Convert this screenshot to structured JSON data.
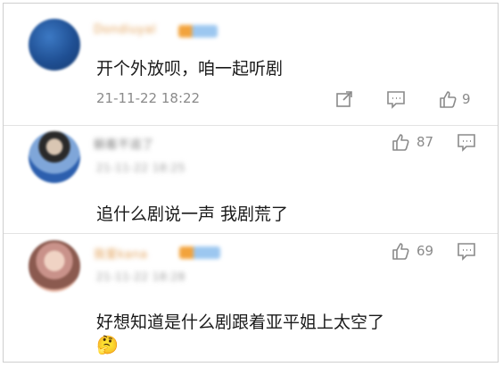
{
  "comments": [
    {
      "username": "Dondiuyal",
      "text": "开个外放呗，咱一起听剧",
      "timestamp": "21-11-22 18:22",
      "like_count": "9",
      "icons": [
        "share-icon",
        "comment-icon",
        "like-icon"
      ]
    },
    {
      "username": "躺着不追了",
      "subtitle": "21-11-22 18:25",
      "like_count": "87",
      "text": "追什么剧说一声 我剧荒了",
      "icons": [
        "like-icon",
        "comment-icon"
      ]
    },
    {
      "username": "我爱kana",
      "subtitle": "21-11-22 18:28",
      "like_count": "69",
      "text": "好想知道是什么剧跟着亚平姐上太空了",
      "emoji": "🤔",
      "icons": [
        "like-icon",
        "comment-icon"
      ]
    }
  ],
  "colors": {
    "username": "#e2a25a",
    "text": "#1a1a1a",
    "meta": "#8a8a8a",
    "divider": "#e3e3e3"
  }
}
